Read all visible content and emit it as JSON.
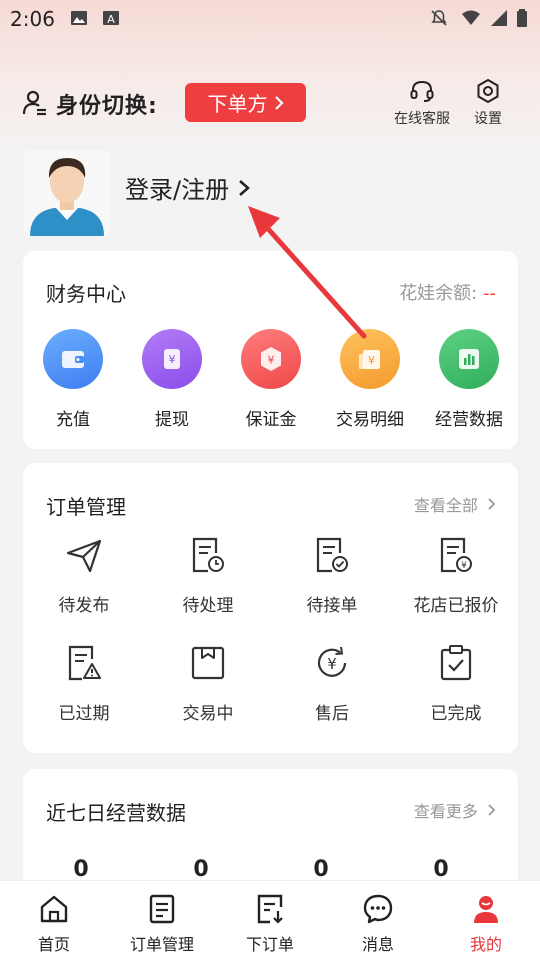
{
  "status_bar": {
    "time": "2:06"
  },
  "header": {
    "switch_label": "身份切换:",
    "role_button": "下单方",
    "service_label": "在线客服",
    "settings_label": "设置"
  },
  "profile": {
    "login_label": "登录/注册"
  },
  "finance": {
    "title": "财务中心",
    "balance_label": "花娃余额:",
    "balance_value": "--",
    "items": [
      {
        "label": "充值",
        "icon": "wallet-icon",
        "color": "#4a90f0"
      },
      {
        "label": "提现",
        "icon": "withdraw-icon",
        "color": "#9b5cf0"
      },
      {
        "label": "保证金",
        "icon": "deposit-icon",
        "color": "#f25d5d"
      },
      {
        "label": "交易明细",
        "icon": "transaction-detail-icon",
        "color": "#f7a93b"
      },
      {
        "label": "经营数据",
        "icon": "business-data-icon",
        "color": "#3fbf6a"
      }
    ]
  },
  "orders": {
    "title": "订单管理",
    "more_label": "查看全部",
    "items": [
      {
        "label": "待发布"
      },
      {
        "label": "待处理"
      },
      {
        "label": "待接单"
      },
      {
        "label": "花店已报价"
      },
      {
        "label": "已过期"
      },
      {
        "label": "交易中"
      },
      {
        "label": "售后"
      },
      {
        "label": "已完成"
      }
    ]
  },
  "stats": {
    "title": "近七日经营数据",
    "more_label": "查看更多",
    "values": [
      "0",
      "0",
      "0",
      "0"
    ]
  },
  "bottom_nav": [
    {
      "label": "首页"
    },
    {
      "label": "订单管理"
    },
    {
      "label": "下订单"
    },
    {
      "label": "消息"
    },
    {
      "label": "我的"
    }
  ],
  "colors": {
    "accent": "#ef3e40",
    "annotation_arrow": "#e8383c"
  }
}
